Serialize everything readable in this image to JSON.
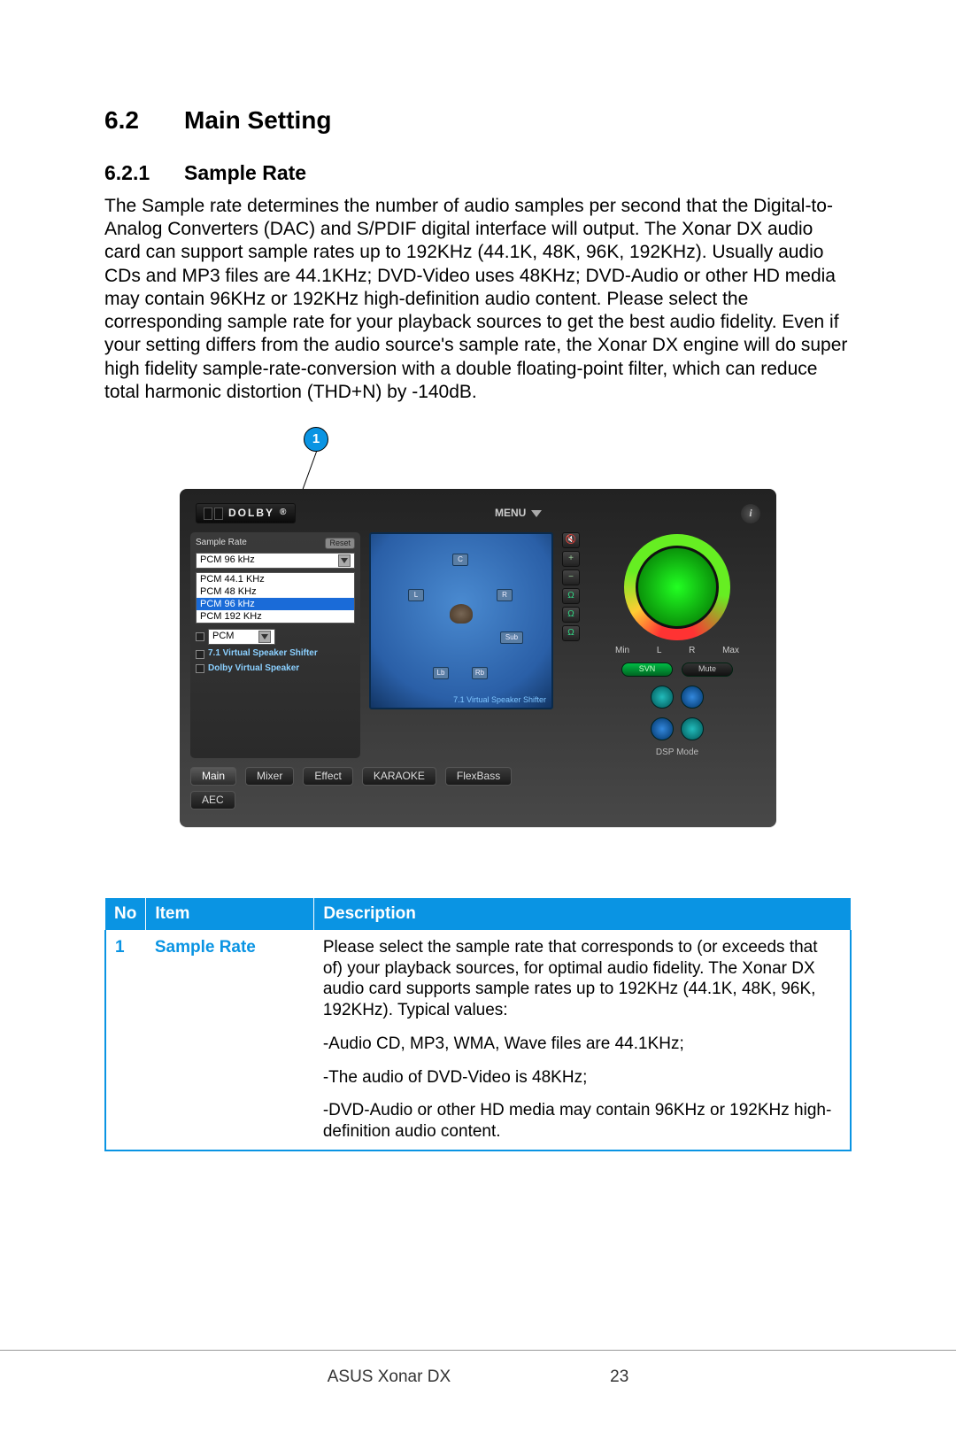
{
  "section": {
    "number": "6.2",
    "title": "Main Setting"
  },
  "subsection": {
    "number": "6.2.1",
    "title": "Sample Rate"
  },
  "paragraph": "The Sample rate determines the number of audio samples per second that the Digital-to-Analog Converters (DAC) and S/PDIF digital interface will output. The Xonar DX audio card can support sample rates up to 192KHz (44.1K, 48K, 96K, 192KHz). Usually audio CDs and MP3 files are 44.1KHz; DVD-Video uses 48KHz; DVD-Audio or other HD media may contain 96KHz or 192KHz high-definition audio content. Please select the corresponding sample rate for your playback sources to get the best audio fidelity. Even if your setting differs from the audio source's sample rate, the Xonar DX engine will do super high fidelity sample-rate-conversion with a double floating-point filter, which can reduce total harmonic distortion (THD+N) by -140dB.",
  "callouts": [
    {
      "id": "1"
    }
  ],
  "app": {
    "logo": "DOLBY",
    "logo_sup": "®",
    "menu": "MENU",
    "left": {
      "label": "Sample Rate",
      "reset": "Reset",
      "selected": "PCM 96 kHz",
      "options": [
        "PCM 44.1 KHz",
        "PCM 48 KHz",
        "PCM 96 kHz",
        "PCM 192 KHz"
      ],
      "pcm": "PCM",
      "chk1": "7.1 Virtual Speaker Shifter",
      "chk2": "Dolby Virtual Speaker"
    },
    "mid": {
      "speakers": {
        "c": "C",
        "l": "L",
        "r": "R",
        "sub": "Sub",
        "lb": "Lb",
        "rb": "Rb"
      },
      "caption": "7.1 Virtual Speaker Shifter"
    },
    "side_icons": [
      "🔇",
      "+",
      "−",
      "Ω",
      "Ω",
      "Ω"
    ],
    "right": {
      "min": "Min",
      "max": "Max",
      "l": "L",
      "r": "R",
      "svn": "SVN",
      "mute": "Mute",
      "dsp": "DSP Mode"
    },
    "tabs": [
      "Main",
      "Mixer",
      "Effect",
      "KARAOKE",
      "FlexBass",
      "AEC"
    ]
  },
  "table": {
    "headers": {
      "no": "No",
      "item": "Item",
      "desc": "Description"
    },
    "rows": [
      {
        "no": "1",
        "item": "Sample Rate",
        "desc": [
          "Please select the sample rate that corresponds to (or exceeds that of) your playback sources, for optimal audio fidelity. The Xonar DX audio card supports sample rates up to 192KHz (44.1K, 48K, 96K, 192KHz). Typical values:",
          "-Audio CD, MP3, WMA, Wave files are 44.1KHz;",
          "-The audio of DVD-Video is 48KHz;",
          "-DVD-Audio or other HD media may contain 96KHz or 192KHz high-definition audio content."
        ]
      }
    ]
  },
  "footer": {
    "product": "ASUS Xonar DX",
    "page": "23"
  }
}
